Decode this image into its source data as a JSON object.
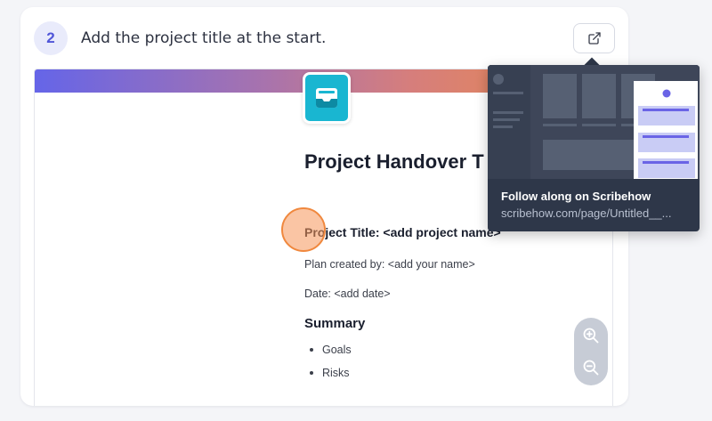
{
  "step": {
    "number": "2",
    "instruction": "Add the project title at the start."
  },
  "icons": {
    "open_external": "external-link-icon",
    "app": "inbox-tray-icon",
    "zoom_in": "zoom-in-icon",
    "zoom_out": "zoom-out-icon"
  },
  "document": {
    "title": "Project Handover T",
    "project_title_line": "Project Title: <add project name>",
    "plan_created_by": "Plan created by: <add your name>",
    "date_line": "Date: <add date>",
    "summary_heading": "Summary",
    "summary_items": [
      "Goals",
      "Risks"
    ]
  },
  "tooltip": {
    "title": "Follow along on Scribehow",
    "url": "scribehow.com/page/Untitled__..."
  },
  "colors": {
    "accent": "#4f55d8",
    "badge_bg": "#e9ebfb",
    "click_marker": "#f0883e",
    "app_icon": "#19b6d1",
    "tooltip_bg": "#2e3749"
  }
}
